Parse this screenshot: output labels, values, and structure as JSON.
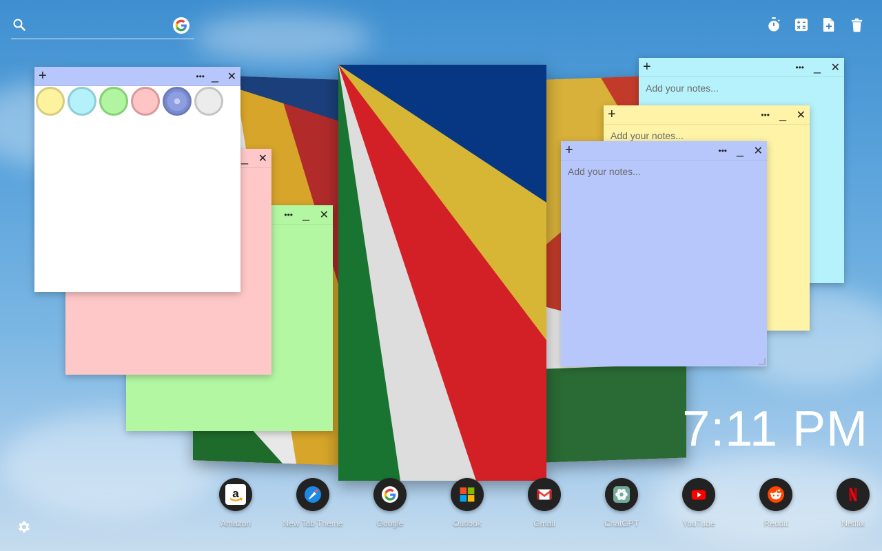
{
  "search": {
    "placeholder": "",
    "value": "",
    "search_icon": "search-icon",
    "provider_icon": "google-icon"
  },
  "toolbar": [
    {
      "name": "timer-icon"
    },
    {
      "name": "calculator-icon"
    },
    {
      "name": "new-note-icon"
    },
    {
      "name": "trash-icon"
    }
  ],
  "notes": {
    "placeholder": "Add your notes...",
    "add_label": "+",
    "menu_label": "•••",
    "minimize_label": "_",
    "close_label": "✕",
    "colors": {
      "white": "#ffffff",
      "pink": "#ffc8c8",
      "green": "#b3f7a3",
      "cyan": "#b6f2fb",
      "yellow": "#fef3a6",
      "periwinkle": "#b7c7fc"
    }
  },
  "palette": [
    {
      "name": "yellow",
      "fill": "#fdf39e",
      "border": "#d6cc7e"
    },
    {
      "name": "cyan",
      "fill": "#b5f1fb",
      "border": "#8ccdd8"
    },
    {
      "name": "green",
      "fill": "#b1f5a0",
      "border": "#86cf78"
    },
    {
      "name": "pink",
      "fill": "#ffc4c4",
      "border": "#d99a9a"
    },
    {
      "name": "blue",
      "fill": "#8d9fe0",
      "border": "#6c7bb6"
    },
    {
      "name": "gray",
      "fill": "#ececec",
      "border": "#c4c4c4"
    }
  ],
  "clock": {
    "time": "7:11 PM"
  },
  "dock": [
    {
      "label": "Amazon",
      "icon": "amazon-icon"
    },
    {
      "label": "New Tab Theme",
      "icon": "new-tab-theme-icon"
    },
    {
      "label": "Google",
      "icon": "google-icon"
    },
    {
      "label": "Outlook",
      "icon": "outlook-icon"
    },
    {
      "label": "Gmail",
      "icon": "gmail-icon"
    },
    {
      "label": "ChatGPT",
      "icon": "chatgpt-icon"
    },
    {
      "label": "YouTube",
      "icon": "youtube-icon"
    },
    {
      "label": "Reddit",
      "icon": "reddit-icon"
    },
    {
      "label": "Netflix",
      "icon": "netflix-icon"
    }
  ],
  "settings": {
    "icon": "gear-icon"
  }
}
